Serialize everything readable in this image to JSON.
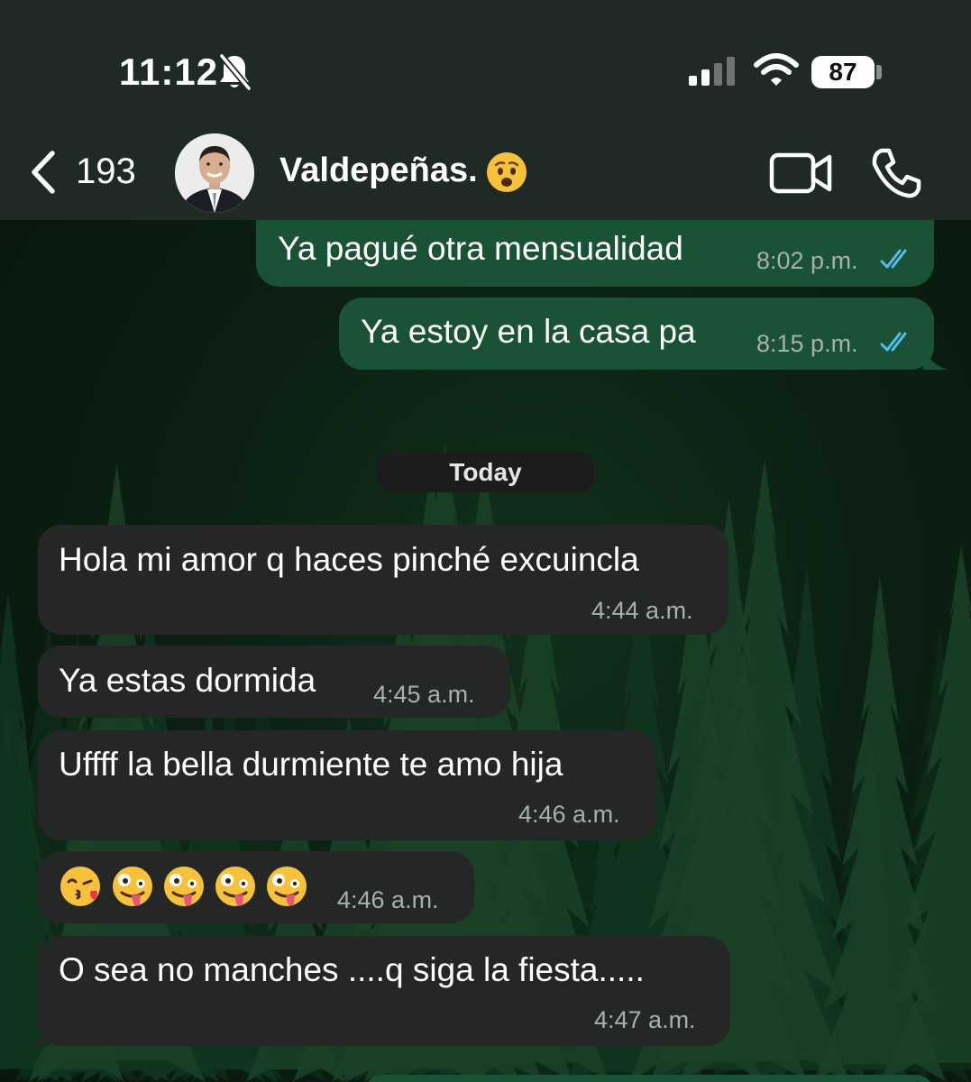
{
  "status_bar": {
    "time": "11:12",
    "battery_level": "87"
  },
  "header": {
    "back_count": "193",
    "contact_name": "Valdepeñas."
  },
  "date_separator": "Today",
  "messages": [
    {
      "direction": "outgoing",
      "text": "Ya pagué otra mensualidad",
      "time": "8:02 p.m.",
      "status": "read"
    },
    {
      "direction": "outgoing",
      "text": "Ya estoy en la casa pa",
      "time": "8:15 p.m.",
      "status": "read"
    },
    {
      "direction": "incoming",
      "text": "Hola mi amor q haces pinché excuincla",
      "time": "4:44 a.m."
    },
    {
      "direction": "incoming",
      "text": "Ya estas dormida",
      "time": "4:45 a.m."
    },
    {
      "direction": "incoming",
      "text": "Uffff la bella durmiente te amo hija",
      "time": "4:46 a.m."
    },
    {
      "direction": "incoming",
      "emojis": [
        "kissing-heart-emoji",
        "zany-face-emoji",
        "zany-face-emoji",
        "zany-face-emoji",
        "zany-face-emoji"
      ],
      "time": "4:46 a.m."
    },
    {
      "direction": "incoming",
      "text": "O sea no manches ....q siga la fiesta.....",
      "time": "4:47 a.m."
    }
  ],
  "colors": {
    "header_bg": "#1f2a24",
    "outgoing_bubble": "#1a5236",
    "incoming_bubble": "#252727",
    "read_ticks": "#53bdeb"
  }
}
